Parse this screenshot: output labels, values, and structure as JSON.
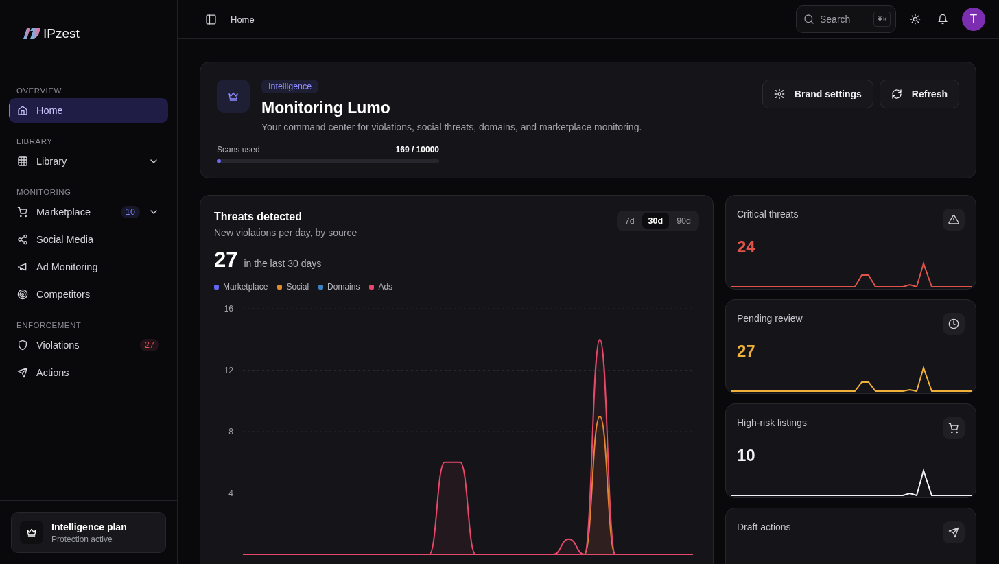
{
  "brand": {
    "name": "IPzest"
  },
  "sidebar": {
    "sections": [
      {
        "label": "OVERVIEW",
        "items": [
          {
            "label": "Home",
            "kind": "link",
            "selected": true
          }
        ]
      },
      {
        "label": "LIBRARY",
        "items": [
          {
            "label": "Library",
            "kind": "group",
            "selected": false
          }
        ]
      },
      {
        "label": "MONITORING",
        "items": [
          {
            "label": "Marketplace",
            "kind": "group",
            "selected": false,
            "badge": {
              "text": "10",
              "kind": "accent"
            }
          },
          {
            "label": "Social Media",
            "kind": "link",
            "selected": false
          },
          {
            "label": "Ad Monitoring",
            "kind": "link",
            "selected": false
          },
          {
            "label": "Competitors",
            "kind": "link",
            "selected": false
          }
        ]
      },
      {
        "label": "ENFORCEMENT",
        "items": [
          {
            "label": "Violations",
            "kind": "link",
            "selected": false,
            "badge": {
              "text": "27",
              "kind": "danger"
            }
          },
          {
            "label": "Actions",
            "kind": "link",
            "selected": false
          }
        ]
      }
    ],
    "plan": {
      "title": "Intelligence plan",
      "subtitle": "Protection active"
    }
  },
  "topbar": {
    "breadcrumb": "Home",
    "search": {
      "placeholder": "Search",
      "shortcut": "⌘K"
    },
    "avatar": "T"
  },
  "hero": {
    "tag": "Intelligence",
    "title": "Monitoring Lumo",
    "description": "Your command center for violations, social threats, domains, and marketplace monitoring.",
    "buttons": [
      "Brand settings",
      "Refresh"
    ],
    "usage": {
      "label": "Scans used",
      "reading": "169 / 10000",
      "level": 0.0169
    }
  },
  "threats": {
    "title": "Threats detected",
    "subtitle": "New violations per day, by source",
    "total": "27",
    "total_caption": "in the last 30 days",
    "ranges": [
      {
        "label": "7d",
        "selected": false
      },
      {
        "label": "30d",
        "selected": true
      },
      {
        "label": "90d",
        "selected": false
      }
    ],
    "chart_data": {
      "type": "area",
      "stacked": false,
      "grid": true,
      "yticks": [
        4,
        8,
        12,
        16
      ],
      "ylim": [
        0,
        16
      ],
      "series": [
        {
          "name": "Marketplace",
          "color": "#6366f1",
          "values": [
            null,
            null,
            null,
            null,
            null,
            null,
            null,
            null,
            null,
            null,
            null,
            null,
            null,
            null,
            null,
            null,
            null,
            null,
            null,
            null,
            null,
            null,
            null,
            null,
            null,
            null,
            null,
            null,
            null,
            null
          ]
        },
        {
          "name": "Social",
          "color": "#e08a2e",
          "values": [
            0,
            0,
            0,
            0,
            0,
            0,
            0,
            0,
            0,
            0,
            0,
            0,
            0,
            0,
            0,
            0,
            0,
            0,
            0,
            0,
            0,
            0,
            0,
            9,
            0,
            0,
            0,
            0,
            0,
            0
          ]
        },
        {
          "name": "Domains",
          "color": "#3b82c4",
          "values": [
            null,
            null,
            null,
            null,
            null,
            null,
            null,
            null,
            null,
            null,
            null,
            null,
            null,
            null,
            null,
            null,
            null,
            null,
            null,
            null,
            null,
            null,
            null,
            null,
            null,
            null,
            null,
            null,
            null,
            null
          ]
        },
        {
          "name": "Ads",
          "color": "#e5486a",
          "values": [
            0,
            0,
            0,
            0,
            0,
            0,
            0,
            0,
            0,
            0,
            0,
            0,
            0,
            6,
            6,
            0,
            0,
            0,
            0,
            0,
            0,
            1,
            0,
            14,
            0,
            0,
            0,
            0,
            0,
            0
          ]
        }
      ]
    }
  },
  "stats": [
    {
      "title": "Critical threats",
      "value": "24",
      "color": "#e0524a"
    },
    {
      "title": "Pending review",
      "value": "27",
      "color": "#f0b13a"
    },
    {
      "title": "High-risk listings",
      "value": "10",
      "color": "#f4f4f6"
    },
    {
      "title": "Draft actions"
    }
  ]
}
